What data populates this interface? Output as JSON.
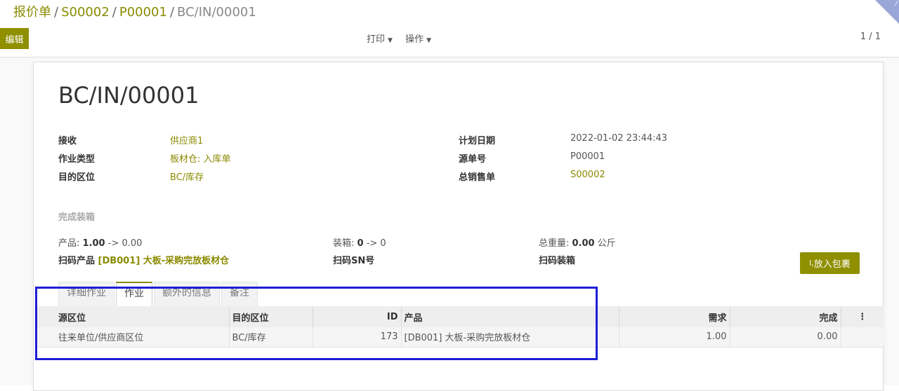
{
  "breadcrumb": {
    "items": [
      "报价单",
      "S00002",
      "P00001"
    ],
    "current": "BC/IN/00001",
    "separator": "/"
  },
  "toolbar": {
    "edit_label": "编辑",
    "print_label": "打印",
    "action_label": "操作",
    "pager": "1 / 1"
  },
  "record": {
    "title": "BC/IN/00001",
    "left_fields": [
      {
        "label": "接收",
        "value": "供应商1"
      },
      {
        "label": "作业类型",
        "value": "板材仓: 入库单"
      },
      {
        "label": "目的区位",
        "value": "BC/库存"
      }
    ],
    "right_fields": [
      {
        "label": "计划日期",
        "value": "2022-01-02 23:44:43"
      },
      {
        "label": "源单号",
        "value": "P00001"
      },
      {
        "label": "总销售单",
        "value": "S00002"
      }
    ]
  },
  "packing": {
    "section_title": "完成装箱",
    "product_label": "产品:",
    "product_value": "1.00",
    "product_arrow": "-> 0.00",
    "box_label": "装箱:",
    "box_value": "0",
    "box_arrow": "-> 0",
    "weight_label": "总重量:",
    "weight_value": "0.00",
    "weight_unit": "公斤",
    "scan_product_label": "扫码产品",
    "scan_product_value": "[DB001] 大板-采购完放板材仓",
    "scan_sn_label": "扫码SN号",
    "scan_box_label": "扫码装箱",
    "put_in_pack_label": "放入包裹"
  },
  "tabs": [
    {
      "label": "详细作业",
      "active": false
    },
    {
      "label": "作业",
      "active": true
    },
    {
      "label": "额外的信息",
      "active": false
    },
    {
      "label": "备注",
      "active": false
    }
  ],
  "table": {
    "headers": [
      "源区位",
      "目的区位",
      "ID",
      "产品",
      "需求",
      "完成",
      "⋮"
    ],
    "rows": [
      [
        "往来单位/供应商区位",
        "BC/库存",
        "173",
        "[DB001] 大板-采购完放板材仓",
        "1.00",
        "0.00",
        ""
      ]
    ]
  },
  "colors": {
    "brand": "#8f8f00",
    "link": "#8a8a00",
    "highlight_box": "#1d1dd6"
  }
}
